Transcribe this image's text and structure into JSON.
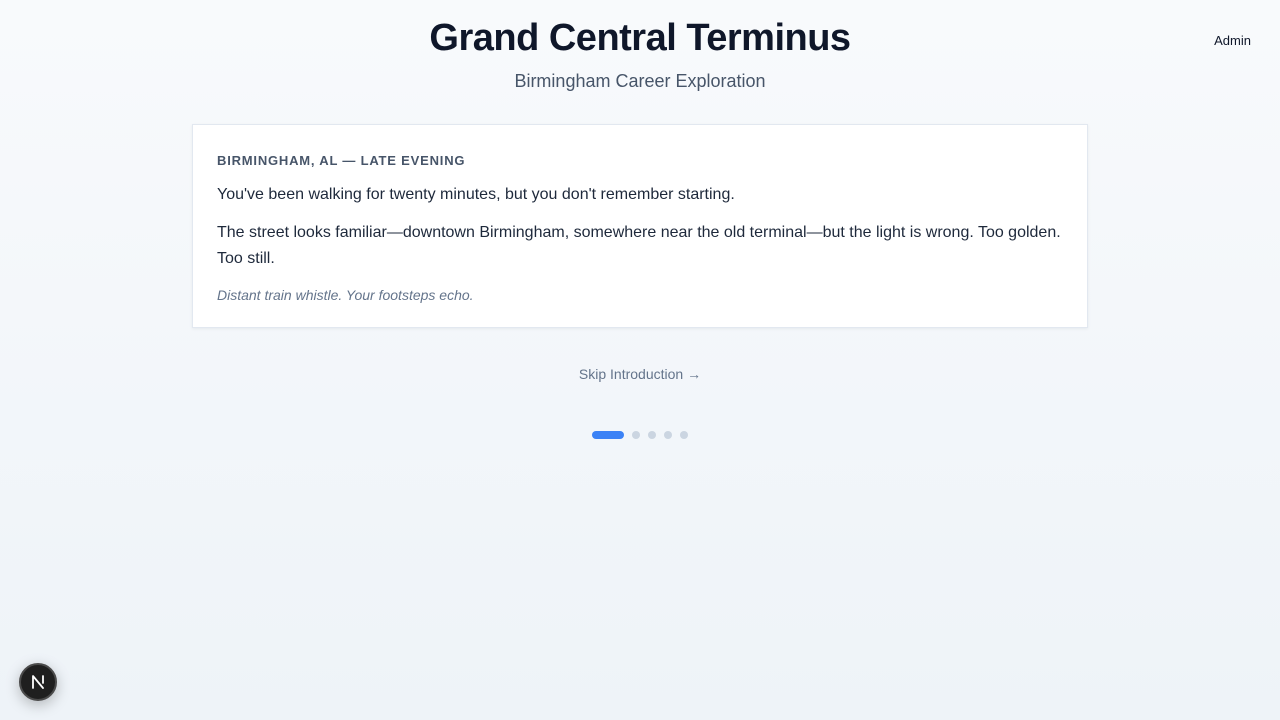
{
  "header": {
    "title": "Grand Central Terminus",
    "subtitle": "Birmingham Career Exploration",
    "admin_label": "Admin"
  },
  "story": {
    "location": "BIRMINGHAM, AL — LATE EVENING",
    "paragraphs": [
      "You've been walking for twenty minutes, but you don't remember starting.",
      "The street looks familiar—downtown Birmingham, somewhere near the old terminal—but the light is wrong. Too golden. Too still."
    ],
    "ambient": "Distant train whistle. Your footsteps echo."
  },
  "controls": {
    "skip_label": "Skip Introduction →"
  },
  "progress": {
    "total_steps": 5,
    "current_step": 1
  },
  "dev_badge": {
    "icon": "nextjs-n-icon",
    "letter": "N"
  },
  "colors": {
    "accent": "#3b82f6",
    "dot_inactive": "#cbd5e1",
    "title": "#0f172a"
  }
}
